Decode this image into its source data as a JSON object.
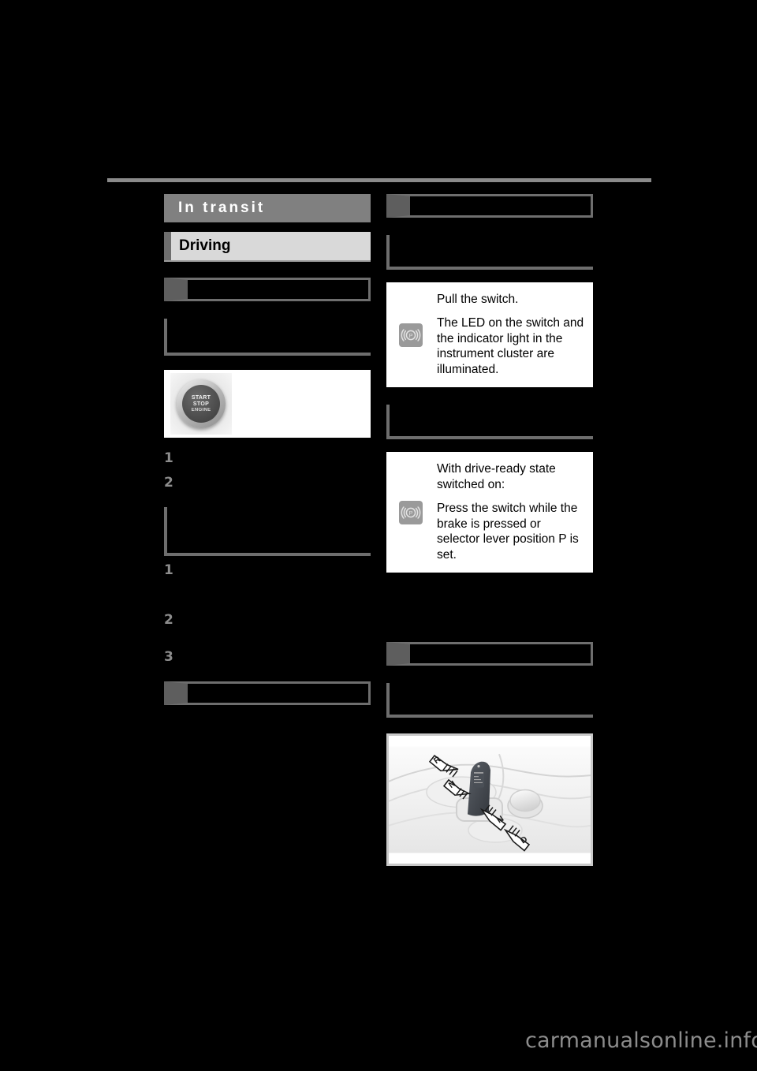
{
  "page": {
    "background": "#000000",
    "accent_gray": "#808080",
    "section_gray": "#d9d9d9",
    "tab_gray": "#6e6e6e"
  },
  "chapter": {
    "title": "In transit"
  },
  "section": {
    "title": "Driving"
  },
  "left_column": {
    "subheading_1": "",
    "list_a": [
      "1",
      "2"
    ],
    "list_b": [
      "1",
      "2",
      "3"
    ],
    "subheading_2": "",
    "figure_start_stop": {
      "label": "start-stop-engine-button",
      "button_line1": "START",
      "button_line2": "STOP",
      "button_line3": "ENGINE"
    }
  },
  "right_column": {
    "subheading_1": "",
    "callouts": [
      {
        "icon": "parking-brake-icon",
        "paragraphs": [
          "Pull the switch.",
          "The LED on the switch and the indicator light in the instrument cluster are illuminated."
        ]
      },
      {
        "icon": "parking-brake-icon",
        "paragraphs": [
          "With drive-ready state switched on:",
          "Press the switch while the brake is pressed or selector lever position P is set."
        ]
      }
    ],
    "subheading_2": "",
    "figure_selector_lever": {
      "label": "selector-lever-diagram",
      "positions": [
        "R",
        "N",
        "N",
        "D"
      ]
    }
  },
  "watermark": {
    "text": "carmanualsonline.info"
  }
}
